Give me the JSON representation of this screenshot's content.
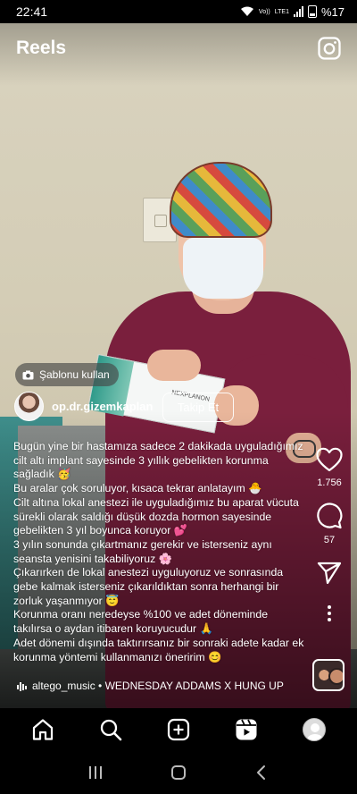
{
  "status_bar": {
    "time": "22:41",
    "network_label": "Vo))",
    "lte_label": "LTE1",
    "battery": "%17"
  },
  "header": {
    "title": "Reels"
  },
  "template_chip": {
    "label": "Şablonu kullan"
  },
  "author": {
    "username": "op.dr.gizemkaplan",
    "follow_label": "Takip Et"
  },
  "caption": {
    "lines": [
      "Bugün yine bir hastamıza sadece 2 dakikada uyguladığımız cilt altı implant sayesinde 3 yıllık gebelikten korunma sağladık 🥳",
      "Bu aralar çok soruluyor, kısaca tekrar anlatayım 🐣",
      "Cilt altına lokal anestezi ile uyguladığımız bu aparat vücuta sürekli olarak saldığı düşük dozda hormon sayesinde gebelikten 3 yıl boyunca koruyor 💕",
      "3 yılın sonunda çıkartmanız gerekir ve isterseniz aynı seansta yenisini takabiliyoruz 🌸",
      "Çıkarırken de lokal anestezi uyguluyoruz ve sonrasında gebe kalmak isterseniz çıkarıldıktan sonra herhangi bir zorluk yaşanmıyor 😇",
      "Korunma oranı neredeyse %100 ve adet döneminde takılırsa o aydan itibaren koruyucudur 🙏",
      "Adet dönemi dışında taktırırsanız bir sonraki adete kadar ek korunma yöntemi kullanmanızı öneririm 😊"
    ]
  },
  "actions": {
    "like_count": "1.756",
    "comment_count": "57"
  },
  "audio": {
    "label": "altego_music • WEDNESDAY ADDAMS X HUNG UP"
  },
  "icons": {
    "camera": "camera-icon",
    "like": "heart-icon",
    "comment": "comment-icon",
    "share": "send-icon",
    "more": "more-vertical-icon",
    "home": "home-icon",
    "search": "search-icon",
    "create": "plus-square-icon",
    "reels": "reels-icon",
    "profile": "profile-avatar",
    "music": "music-bars-icon"
  }
}
